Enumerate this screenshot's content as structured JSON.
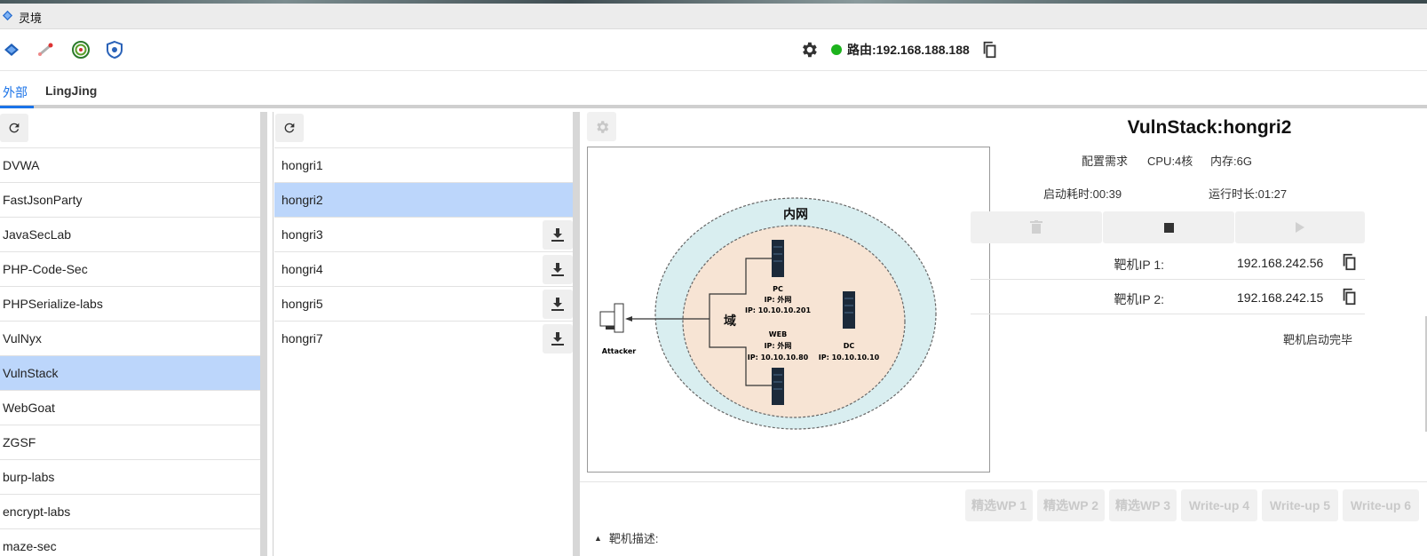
{
  "window": {
    "title": "灵境"
  },
  "toolbar": {
    "icons": [
      "diamond-logo-icon",
      "rocket-icon",
      "target-icon",
      "shield-icon"
    ],
    "route_label": "路由:192.168.188.188",
    "route_status_color": "#1db31d"
  },
  "tabs": [
    {
      "label": "外部",
      "active": true
    },
    {
      "label": "LingJing",
      "active": false
    }
  ],
  "categories": {
    "items": [
      "DVWA",
      "FastJsonParty",
      "JavaSecLab",
      "PHP-Code-Sec",
      "PHPSerialize-labs",
      "VulNyx",
      "VulnStack",
      "WebGoat",
      "ZGSF",
      "burp-labs",
      "encrypt-labs",
      "maze-sec"
    ],
    "selected": "VulnStack"
  },
  "machines": {
    "items": [
      {
        "name": "hongri1",
        "download": false
      },
      {
        "name": "hongri2",
        "download": false,
        "selected": true
      },
      {
        "name": "hongri3",
        "download": true
      },
      {
        "name": "hongri4",
        "download": true
      },
      {
        "name": "hongri5",
        "download": true
      },
      {
        "name": "hongri7",
        "download": true
      }
    ]
  },
  "topology": {
    "outer_label": "内网",
    "domain_label": "域",
    "attacker_label": "Attacker",
    "pc_name": "PC",
    "pc_ip1": "IP: 外网",
    "pc_ip2": "IP: 10.10.10.201",
    "web_name": "WEB",
    "web_ip1": "IP: 外网",
    "web_ip2": "IP: 10.10.10.80",
    "dc_name": "DC",
    "dc_ip": "IP: 10.10.10.10"
  },
  "detail": {
    "title": "VulnStack:hongri2",
    "config_label": "配置需求",
    "cpu": "CPU:4核",
    "memory": "内存:6G",
    "boot_time": "启动耗时:00:39",
    "run_time": "运行时长:01:27",
    "ip1_label": "靶机IP 1:",
    "ip1_value": "192.168.242.56",
    "ip2_label": "靶机IP 2:",
    "ip2_value": "192.168.242.15",
    "status": "靶机启动完毕"
  },
  "writeups": [
    "精选WP 1",
    "精选WP 2",
    "精选WP 3",
    "Write-up 4",
    "Write-up 5",
    "Write-up 6"
  ],
  "description_label": "靶机描述:"
}
